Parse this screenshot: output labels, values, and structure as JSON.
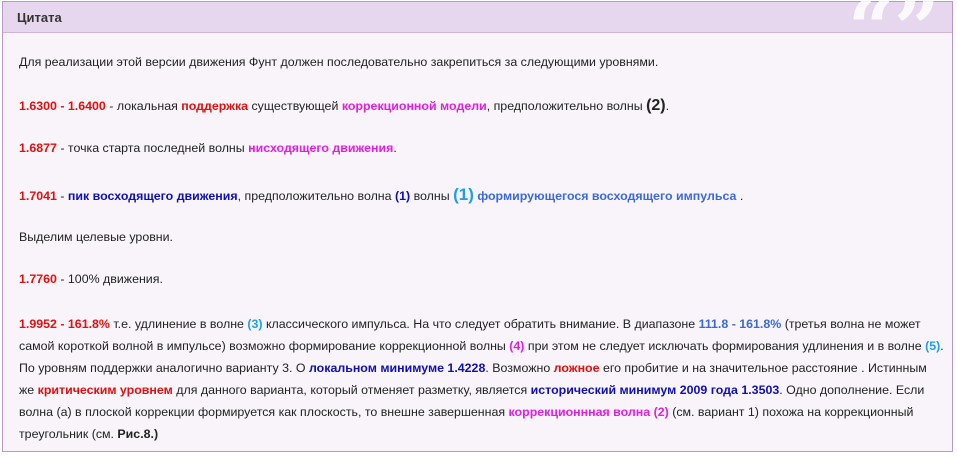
{
  "header": {
    "title": "Цитата",
    "quote_icon": "quote-marks-icon",
    "quote_glyph": "“”"
  },
  "lines": {
    "l1": "Для реализации этой версии движения Фунт должен последовательно закрепиться за следующими уровнями.",
    "l2a": "1.6300 - 1.6400",
    "l2b": " - локальная ",
    "l2c": "поддержка",
    "l2d": " существующей ",
    "l2e": "коррекционной модели",
    "l2f": ", предположительно волны ",
    "l2g": "(2)",
    "l2h": ".",
    "l3a": "1.6877",
    "l3b": " - точка старта последней волны ",
    "l3c": "нисходящего движения",
    "l3d": ".",
    "l4a": "1.7041",
    "l4b": " - ",
    "l4c": "пик восходящего движения",
    "l4d": ", предположительно волна ",
    "l4e": "(1)",
    "l4f": " волны ",
    "l4g": "(1)",
    "l4h": " ",
    "l4i": "формирующегося восходящего импульса",
    "l4j": " .",
    "l5": "Выделим целевые уровни.",
    "l6a": "1.7760",
    "l6b": " - 100% движения.",
    "p1": "1.9952 - 161.8%",
    "p2": " т.е. удлинение в волне ",
    "p3": "(3)",
    "p4": " классического импульса. На что следует обратить внимание. В диапазоне ",
    "p5": "111.8 - 161.8%",
    "p6": " (третья волна не может самой короткой волной в импульсе) возможно формирование коррекционной волны ",
    "p7": "(4)",
    "p8": " при этом не следует исключать формирования удлинения и в волне ",
    "p9": "(5)",
    "p10": ". По уровням поддержки аналогично варианту 3. О ",
    "p11": "локальном минимуме 1.4228",
    "p12": ". Возможно ",
    "p13": "ложное",
    "p14": " его пробитие и на значительное расстояние . Истинным же ",
    "p15": "критическим уровнем",
    "p16": " для данного варианта, который отменяет разметку, является ",
    "p17": "исторический минимум 2009 года 1.3503",
    "p18": ". Одно дополнение. Если волна (а) в плоской коррекции формируется как плоскость, то внешне завершенная ",
    "p19": "коррекционнная волна",
    "p20": " ",
    "p21": "(2)",
    "p22": " (см. вариант 1) похожа на коррекционный треугольник (см. ",
    "p23": "Рис.8.)"
  }
}
